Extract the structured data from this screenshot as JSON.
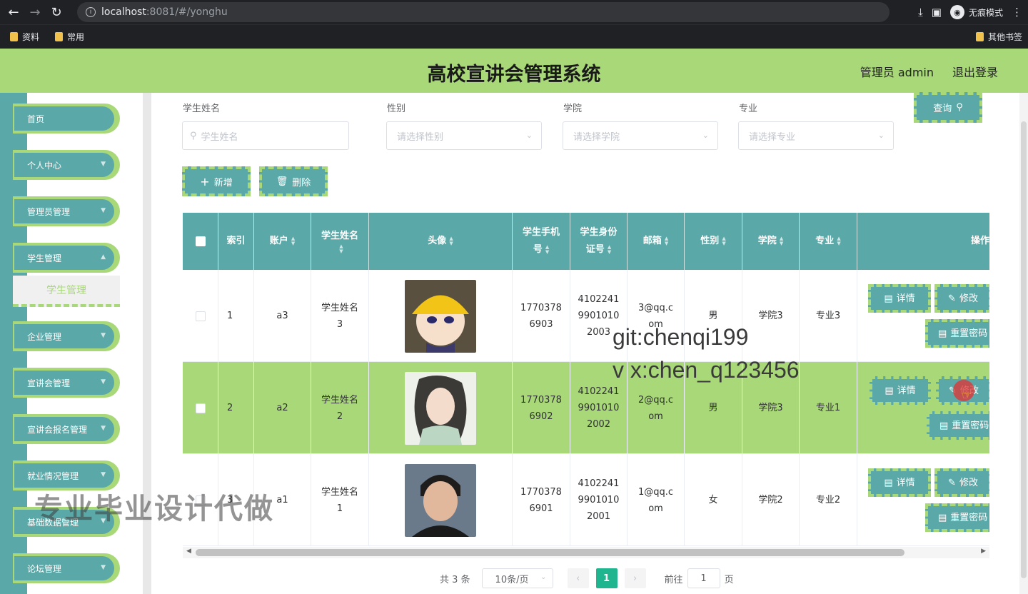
{
  "browser": {
    "url_host": "localhost",
    "url_rest": ":8081/#/yonghu",
    "incognito_label": "无痕模式",
    "bookmarks": [
      "资料",
      "常用"
    ],
    "bookmarks_right": "其他书签"
  },
  "header": {
    "title": "高校宣讲会管理系统",
    "user": "管理员 admin",
    "logout": "退出登录"
  },
  "sidebar": {
    "items": [
      {
        "label": "首页"
      },
      {
        "label": "个人中心"
      },
      {
        "label": "管理员管理"
      },
      {
        "label": "学生管理"
      },
      {
        "label": "企业管理"
      },
      {
        "label": "宣讲会管理"
      },
      {
        "label": "宣讲会报名管理"
      },
      {
        "label": "就业情况管理"
      },
      {
        "label": "基础数据管理"
      },
      {
        "label": "论坛管理"
      }
    ],
    "active_sub": "学生管理"
  },
  "filters": {
    "name_label": "学生姓名",
    "name_placeholder": "学生姓名",
    "gender_label": "性别",
    "gender_placeholder": "请选择性别",
    "college_label": "学院",
    "college_placeholder": "请选择学院",
    "major_label": "专业",
    "major_placeholder": "请选择专业",
    "query_button": "查询"
  },
  "actions": {
    "add": "新增",
    "delete": "删除"
  },
  "table": {
    "headers": {
      "index": "索引",
      "account": "账户",
      "name": "学生姓名",
      "avatar": "头像",
      "phone": "学生手机号",
      "idcard": "学生身份证号",
      "email": "邮箱",
      "gender": "性别",
      "college": "学院",
      "major": "专业",
      "ops": "操作"
    },
    "rows": [
      {
        "index": "1",
        "account": "a3",
        "name": "学生姓名3",
        "phone": "17703786903",
        "idcard": "410224199010102003",
        "email": "3@qq.com",
        "gender": "男",
        "college": "学院3",
        "major": "专业3"
      },
      {
        "index": "2",
        "account": "a2",
        "name": "学生姓名2",
        "phone": "17703786902",
        "idcard": "410224199010102002",
        "email": "2@qq.com",
        "gender": "男",
        "college": "学院3",
        "major": "专业1"
      },
      {
        "index": "3",
        "account": "a1",
        "name": "学生姓名1",
        "phone": "17703786901",
        "idcard": "410224199010102001",
        "email": "1@qq.com",
        "gender": "女",
        "college": "学院2",
        "major": "专业2"
      }
    ],
    "op_detail": "详情",
    "op_edit": "修改",
    "op_reset": "重置密码"
  },
  "pagination": {
    "total": "共 3 条",
    "page_size": "10条/页",
    "current": "1",
    "goto_label": "前往",
    "goto_value": "1",
    "goto_unit": "页"
  },
  "watermarks": {
    "line1": "git:chenqi199",
    "line2": "v x:chen_q123456",
    "line3": "专业毕业设计代做"
  },
  "colors": {
    "accent_green": "#a8d878",
    "teal": "#5aa8a8",
    "page_active": "#1fb68f"
  }
}
